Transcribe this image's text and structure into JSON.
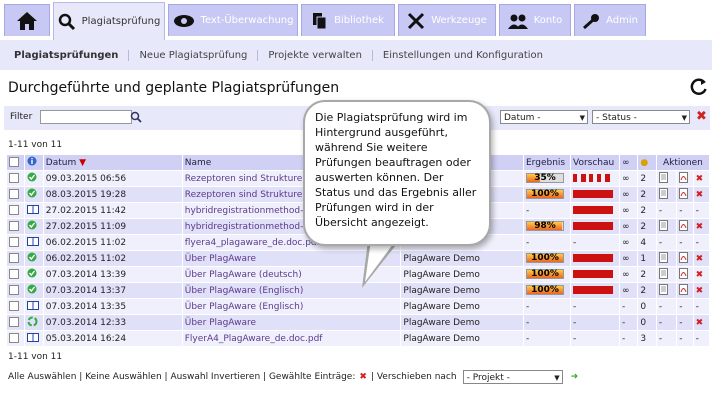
{
  "tabs": [
    {
      "label": "",
      "icon": "home-icon"
    },
    {
      "label": "Plagiatsprüfung",
      "icon": "search-icon"
    },
    {
      "label": "Text-Überwachung",
      "icon": "eye-icon"
    },
    {
      "label": "Bibliothek",
      "icon": "library-icon"
    },
    {
      "label": "Werkzeuge",
      "icon": "tools-icon"
    },
    {
      "label": "Konto",
      "icon": "users-icon"
    },
    {
      "label": "Admin",
      "icon": "key-icon"
    }
  ],
  "subnav": [
    "Plagiatsprüfungen",
    "Neue Plagiatsprüfung",
    "Projekte verwalten",
    "Einstellungen und Konfiguration"
  ],
  "page_title": "Durchgeführte und geplante Plagiatsprüfungen",
  "filter": {
    "label": "Filter",
    "value": "",
    "datum": "Datum -",
    "status": "- Status -"
  },
  "count_top": "1-11 von 11",
  "count_bottom": "1-11 von 11",
  "columns": {
    "datum": "Datum",
    "name": "Name",
    "ergebnis": "Ergebnis",
    "vorschau": "Vorschau",
    "aktionen": "Aktionen"
  },
  "rows": [
    {
      "status": "check",
      "date": "09.03.2015 06:56",
      "name": "Rezeptoren sind Strukturen",
      "owner": "",
      "result": "35%",
      "pct": 0.35,
      "pv": [
        0.1,
        0.12,
        0.1,
        0.1,
        0.12
      ],
      "num": "2",
      "dash": false
    },
    {
      "status": "check",
      "date": "08.03.2015 19:28",
      "name": "Rezeptoren sind Strukturen",
      "owner": "",
      "result": "100%",
      "pct": 1,
      "pv": [
        1
      ],
      "num": "2",
      "dash": false
    },
    {
      "status": "book",
      "date": "27.02.2015 11:42",
      "name": "hybridregistrationmethod-sub",
      "owner": "",
      "result": "-",
      "pct": 0,
      "pv": [
        1
      ],
      "num": "2",
      "dash": true
    },
    {
      "status": "check",
      "date": "27.02.2015 11:09",
      "name": "hybridregistrationmethod-sub",
      "owner": "",
      "result": "98%",
      "pct": 0.98,
      "pv": [
        1
      ],
      "num": "2",
      "dash": false
    },
    {
      "status": "book",
      "date": "06.02.2015 11:02",
      "name": "flyera4_plagaware_de.doc.pdf",
      "owner": "",
      "result": "-",
      "pct": 0,
      "pv": [],
      "num": "4",
      "dash": true
    },
    {
      "status": "check",
      "date": "06.02.2015 11:02",
      "name": "Über PlagAware",
      "owner": "PlagAware Demo",
      "result": "100%",
      "pct": 1,
      "pv": [
        1
      ],
      "num": "1",
      "dash": false
    },
    {
      "status": "check",
      "date": "07.03.2014 13:39",
      "name": "Über PlagAware (deutsch)",
      "owner": "PlagAware Demo",
      "result": "100%",
      "pct": 1,
      "pv": [
        1
      ],
      "num": "2",
      "dash": false
    },
    {
      "status": "check",
      "date": "07.03.2014 13:37",
      "name": "Über PlagAware (Englisch)",
      "owner": "PlagAware Demo",
      "result": "100%",
      "pct": 1,
      "pv": [
        1
      ],
      "num": "2",
      "dash": false
    },
    {
      "status": "book",
      "date": "07.03.2014 13:35",
      "name": "Über PlagAware (Englisch)",
      "owner": "PlagAware Demo",
      "result": "-",
      "pct": 0,
      "pv": [],
      "num": "0",
      "dash": true
    },
    {
      "status": "recycle",
      "date": "07.03.2014 12:33",
      "name": "Über PlagAware",
      "owner": "PlagAware Demo",
      "result": "-",
      "pct": 0,
      "pv": [],
      "num": "0",
      "dash": true
    },
    {
      "status": "book",
      "date": "05.03.2014 16:24",
      "name": "FlyerA4_PlagAware_de.doc.pdf",
      "owner": "PlagAware Demo",
      "result": "-",
      "pct": 0,
      "pv": [],
      "num": "3",
      "dash": true
    }
  ],
  "bubble_text": "Die Plagiatsprüfung wird im Hintergrund ausgeführt, während Sie weitere Prüfungen beauftragen oder auswerten können. Der Status und das Ergebnis aller Prüfungen wird in der Übersicht angezeigt.",
  "footer": {
    "all": "Alle Auswählen",
    "none": "Keine Auswählen",
    "invert": "Auswahl Invertieren",
    "selected": "Gewählte Einträge:",
    "move": "Verschieben nach",
    "project": "- Projekt -"
  },
  "colors": {
    "tab": "#c8c8f5",
    "header": "#d0d0f5",
    "row_even": "#f0f0fd",
    "row_odd": "#e0e0f8",
    "bar_red": "#cc1111"
  }
}
